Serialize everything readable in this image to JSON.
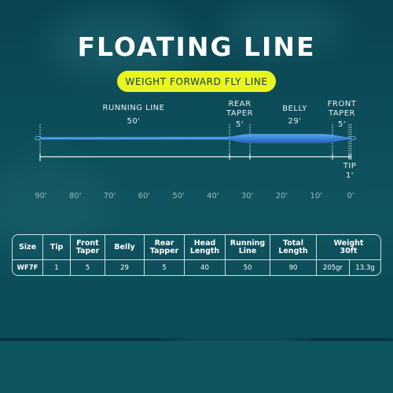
{
  "title": "FLOATING LINE",
  "subtitle": "WEIGHT FORWARD FLY LINE",
  "colors": {
    "accent_pill": "#e8f520",
    "line_blue": "#3a8fe0",
    "belly_blue": "#2f74c8",
    "background": "#0d4e5a"
  },
  "diagram": {
    "total_length_ft": 90,
    "sections": [
      {
        "name": "RUNNING LINE",
        "label_lines": [
          "RUNNING LINE"
        ],
        "length_label": "50'",
        "length_ft": 50
      },
      {
        "name": "REAR TAPER",
        "label_lines": [
          "REAR",
          "TAPER"
        ],
        "length_label": "5'",
        "length_ft": 5
      },
      {
        "name": "BELLY",
        "label_lines": [
          "BELLY"
        ],
        "length_label": "29'",
        "length_ft": 29
      },
      {
        "name": "FRONT TAPER",
        "label_lines": [
          "FRONT",
          "TAPER"
        ],
        "length_label": "5'",
        "length_ft": 5
      },
      {
        "name": "TIP",
        "label_lines": [
          "TIP"
        ],
        "length_label": "1'",
        "length_ft": 1
      }
    ],
    "scale_ticks": [
      "90'",
      "80'",
      "70'",
      "60'",
      "50'",
      "40'",
      "30'",
      "20'",
      "10'",
      "0'"
    ]
  },
  "table": {
    "headers": [
      "Size",
      "Tip",
      "Front Taper",
      "Belly",
      "Rear Tapper",
      "Head Length",
      "Running Line",
      "Total Length",
      "Weight 30ft"
    ],
    "header_lines": [
      [
        "Size"
      ],
      [
        "Tip"
      ],
      [
        "Front",
        "Taper"
      ],
      [
        "Belly"
      ],
      [
        "Rear",
        "Tapper"
      ],
      [
        "Head",
        "Length"
      ],
      [
        "Running",
        "Line"
      ],
      [
        "Total",
        "Length"
      ],
      [
        "Weight",
        "30ft"
      ]
    ],
    "rows": [
      [
        "WF7F",
        "1",
        "5",
        "29",
        "5",
        "40",
        "50",
        "90",
        "205gr",
        "13.3g"
      ]
    ]
  }
}
